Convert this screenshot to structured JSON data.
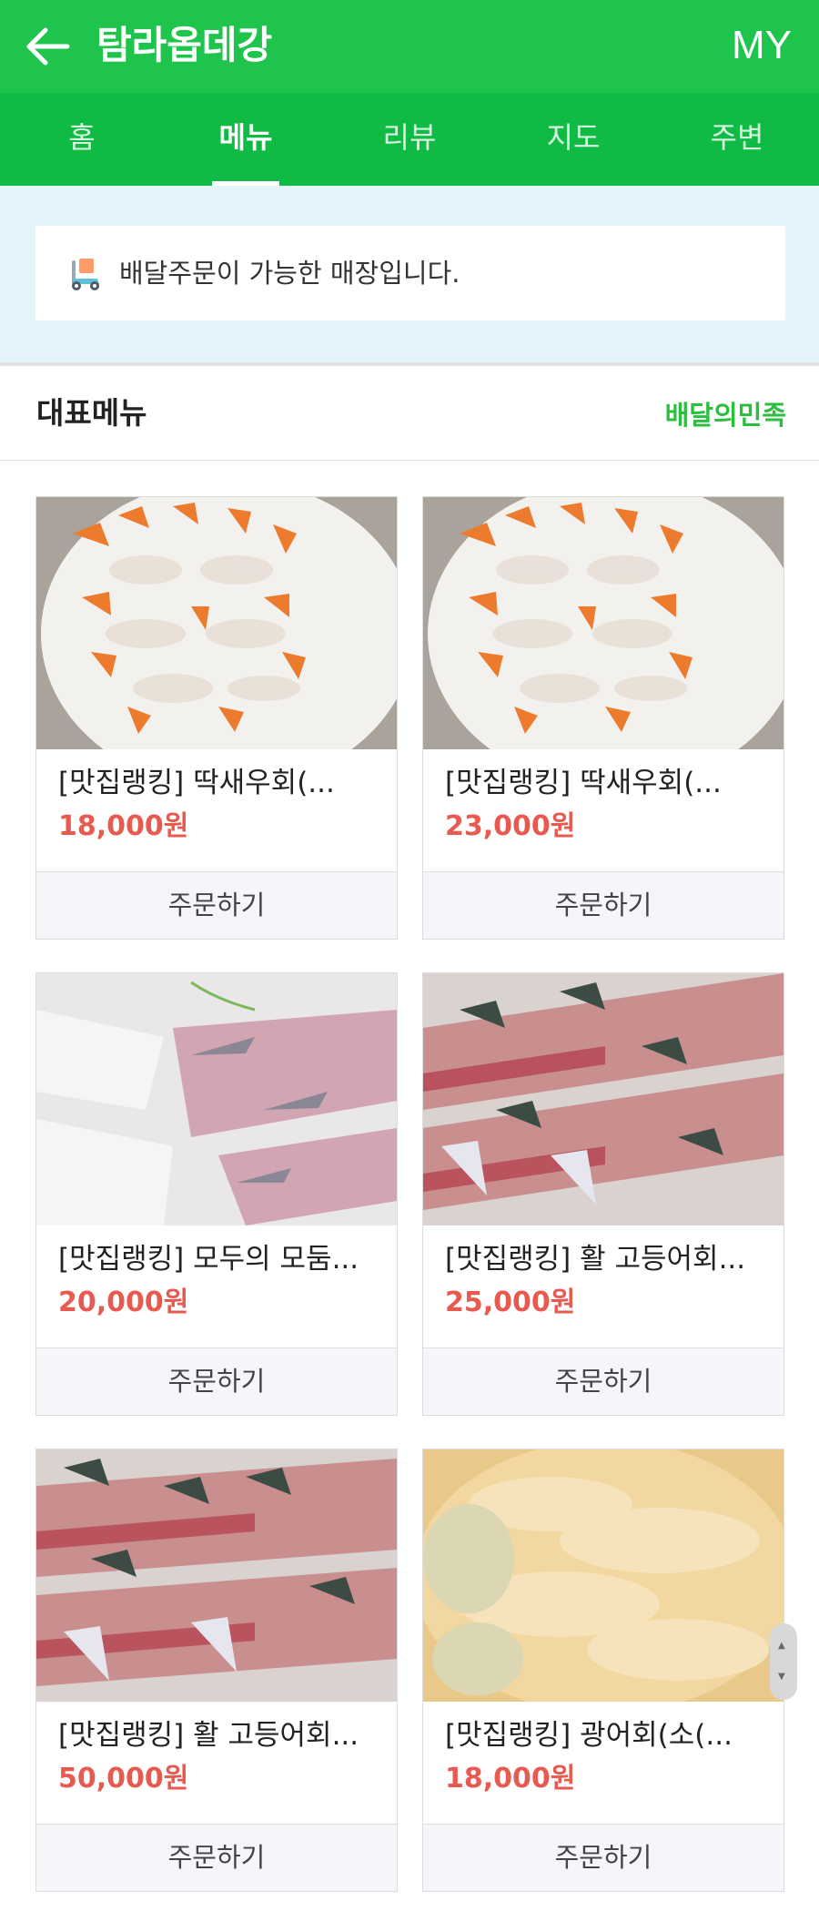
{
  "header": {
    "title": "탐라옵데강",
    "my_label": "MY",
    "colors": {
      "primary": "#1ec44b",
      "tabs": "#0fbb45",
      "price": "#e85a50",
      "link": "#2cbf3f"
    }
  },
  "tabs": [
    {
      "label": "홈",
      "active": false
    },
    {
      "label": "메뉴",
      "active": true
    },
    {
      "label": "리뷰",
      "active": false
    },
    {
      "label": "지도",
      "active": false
    },
    {
      "label": "주변",
      "active": false
    }
  ],
  "notice": {
    "icon": "delivery-scooter-icon",
    "text": "배달주문이 가능한 매장입니다."
  },
  "section": {
    "title": "대표메뉴",
    "link": "배달의민족"
  },
  "menu": [
    {
      "name": "[맛집랭킹] 딱새우회(...",
      "price": "18,000원",
      "order_label": "주문하기"
    },
    {
      "name": "[맛집랭킹] 딱새우회(...",
      "price": "23,000원",
      "order_label": "주문하기"
    },
    {
      "name": "[맛집랭킹] 모두의 모둠...",
      "price": "20,000원",
      "order_label": "주문하기"
    },
    {
      "name": "[맛집랭킹] 활 고등어회...",
      "price": "25,000원",
      "order_label": "주문하기"
    },
    {
      "name": "[맛집랭킹] 활 고등어회...",
      "price": "50,000원",
      "order_label": "주문하기"
    },
    {
      "name": "[맛집랭킹] 광어회(소(...",
      "price": "18,000원",
      "order_label": "주문하기"
    }
  ]
}
